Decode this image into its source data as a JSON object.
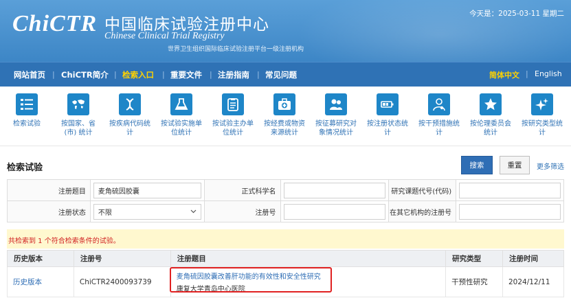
{
  "header": {
    "logo_text": "ChiCTR",
    "site_name_cn": "中国临床试验注册中心",
    "site_name_en": "Chinese Clinical Trial Registry",
    "tagline": "世界卫生组织国际临床试验注册平台一级注册机构",
    "today": "今天是：2025-03-11 星期二",
    "bg_color": "#3d86c6"
  },
  "nav": {
    "items": [
      {
        "label": "网站首页",
        "active": false
      },
      {
        "label": "ChiCTR简介",
        "active": false
      },
      {
        "label": "检索入口",
        "active": true
      },
      {
        "label": "重要文件",
        "active": false
      },
      {
        "label": "注册指南",
        "active": false
      },
      {
        "label": "常见问题",
        "active": false
      }
    ],
    "lang_cn": "简体中文",
    "lang_en": "English",
    "active_color": "#ffd200"
  },
  "icon_nav": [
    {
      "label_lines": [
        "检索试验"
      ],
      "icon": "list-numbered-icon"
    },
    {
      "label_lines": [
        "按国家、省",
        "(市) 统计"
      ],
      "icon": "world-map-icon"
    },
    {
      "label_lines": [
        "按疾病代码统",
        "计"
      ],
      "icon": "dna-icon"
    },
    {
      "label_lines": [
        "按试验实施单",
        "位统计"
      ],
      "icon": "flask-icon"
    },
    {
      "label_lines": [
        "按试验主办单",
        "位统计"
      ],
      "icon": "clipboard-icon"
    },
    {
      "label_lines": [
        "按经费或物资",
        "来源统计"
      ],
      "icon": "medkit-icon"
    },
    {
      "label_lines": [
        "按征募研究对",
        "象情况统计"
      ],
      "icon": "users-icon"
    },
    {
      "label_lines": [
        "按注册状态统",
        "计"
      ],
      "icon": "battery-icon"
    },
    {
      "label_lines": [
        "按干预措施统",
        "计"
      ],
      "icon": "doctor-icon"
    },
    {
      "label_lines": [
        "按伦理委员会",
        "统计"
      ],
      "icon": "star-icon"
    },
    {
      "label_lines": [
        "按研究类型统",
        "计"
      ],
      "icon": "sparkle-icon"
    }
  ],
  "search": {
    "title": "检索试验",
    "search_button": "搜索",
    "reset_button": "重置",
    "more_filter": "更多筛选",
    "fields": {
      "reg_title_label": "注册题目",
      "reg_title_value": "麦角硫因胶囊",
      "sci_title_label": "正式科学名",
      "sci_title_value": "",
      "code_label": "研究课题代号(代码)",
      "code_value": "",
      "status_label": "注册状态",
      "status_value": "不限",
      "reg_no_label": "注册号",
      "reg_no_value": "",
      "other_no_label": "在其它机构的注册号",
      "other_no_value": ""
    }
  },
  "results": {
    "summary": "共检索到 1 个符合检索条件的试验。",
    "columns": [
      "历史版本",
      "注册号",
      "注册题目",
      "研究类型",
      "注册时间"
    ],
    "rows": [
      {
        "history": "历史版本",
        "reg_no": "ChiCTR2400093739",
        "title": "麦角硫因胶囊改善肝功能的有效性和安全性研究",
        "institution": "康复大学青岛中心医院",
        "study_type": "干预性研究",
        "reg_date": "2024/12/11"
      }
    ],
    "highlight_color": "#e02020"
  }
}
